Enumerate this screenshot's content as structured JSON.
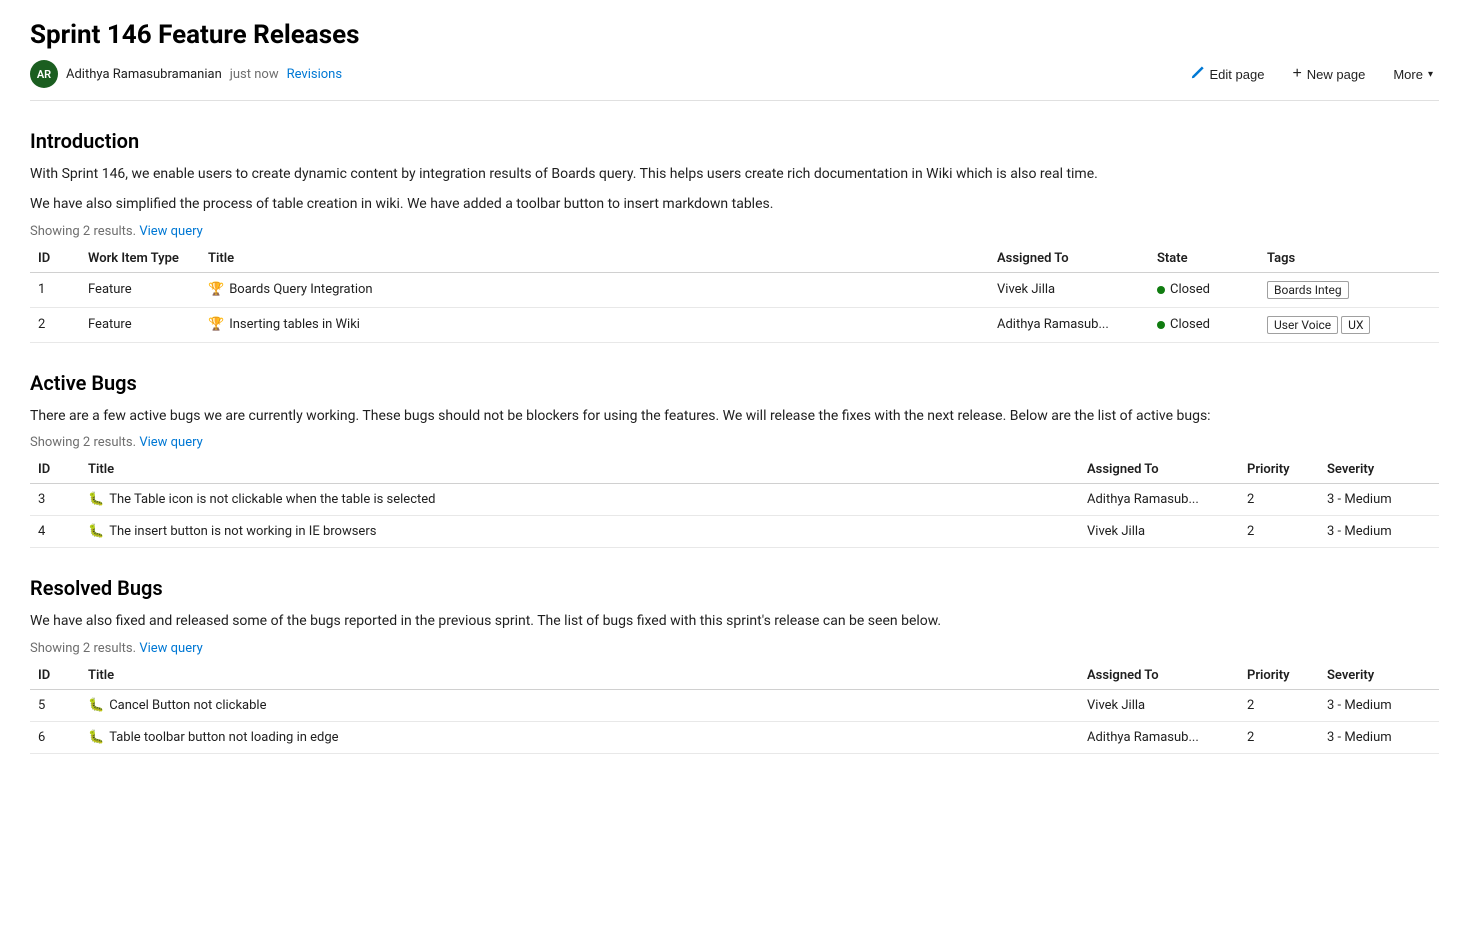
{
  "page": {
    "title": "Sprint 146 Feature Releases"
  },
  "meta": {
    "avatar_initials": "AR",
    "author": "Adithya Ramasubramanian",
    "timestamp": "just now",
    "revisions_label": "Revisions"
  },
  "header_actions": {
    "edit_label": "Edit page",
    "new_page_label": "New page",
    "more_label": "More"
  },
  "introduction": {
    "heading": "Introduction",
    "paragraphs": [
      "With Sprint 146, we enable users to create dynamic content by integration results of Boards query. This helps users create rich documentation in Wiki which is also real time.",
      "We have also simplified the process of table creation in wiki. We have added a toolbar button to insert markdown tables."
    ],
    "showing_results": "Showing 2 results.",
    "view_query_label": "View query",
    "table": {
      "headers": [
        "ID",
        "Work Item Type",
        "Title",
        "Assigned To",
        "State",
        "Tags"
      ],
      "rows": [
        {
          "id": "1",
          "type": "Feature",
          "type_icon": "feature",
          "title": "Boards Query Integration",
          "assigned_to": "Vivek Jilla",
          "state": "Closed",
          "state_type": "closed",
          "tags": [
            "Boards Integ"
          ]
        },
        {
          "id": "2",
          "type": "Feature",
          "type_icon": "feature",
          "title": "Inserting tables in Wiki",
          "assigned_to": "Adithya Ramasub...",
          "state": "Closed",
          "state_type": "closed",
          "tags": [
            "User Voice",
            "UX"
          ]
        }
      ]
    }
  },
  "active_bugs": {
    "heading": "Active Bugs",
    "paragraph": "There are a few active bugs we are currently working. These bugs should not be blockers for using the features. We will release the fixes with the next release. Below are the list of active bugs:",
    "showing_results": "Showing 2 results.",
    "view_query_label": "View query",
    "table": {
      "headers": [
        "ID",
        "Title",
        "Assigned To",
        "Priority",
        "Severity"
      ],
      "rows": [
        {
          "id": "3",
          "type_icon": "bug",
          "title": "The Table icon is not clickable when the table is selected",
          "assigned_to": "Adithya Ramasub...",
          "priority": "2",
          "severity": "3 - Medium"
        },
        {
          "id": "4",
          "type_icon": "bug",
          "title": "The insert button is not working in IE browsers",
          "assigned_to": "Vivek Jilla",
          "priority": "2",
          "severity": "3 - Medium"
        }
      ]
    }
  },
  "resolved_bugs": {
    "heading": "Resolved Bugs",
    "paragraph": "We have also fixed and released some of the bugs reported in the previous sprint. The list of bugs fixed with this sprint's release can be seen below.",
    "showing_results": "Showing 2 results.",
    "view_query_label": "View query",
    "table": {
      "headers": [
        "ID",
        "Title",
        "Assigned To",
        "Priority",
        "Severity"
      ],
      "rows": [
        {
          "id": "5",
          "type_icon": "bug",
          "title": "Cancel Button not clickable",
          "assigned_to": "Vivek Jilla",
          "priority": "2",
          "severity": "3 - Medium"
        },
        {
          "id": "6",
          "type_icon": "bug",
          "title": "Table toolbar button not loading in edge",
          "assigned_to": "Adithya Ramasub...",
          "priority": "2",
          "severity": "3 - Medium"
        }
      ]
    }
  }
}
